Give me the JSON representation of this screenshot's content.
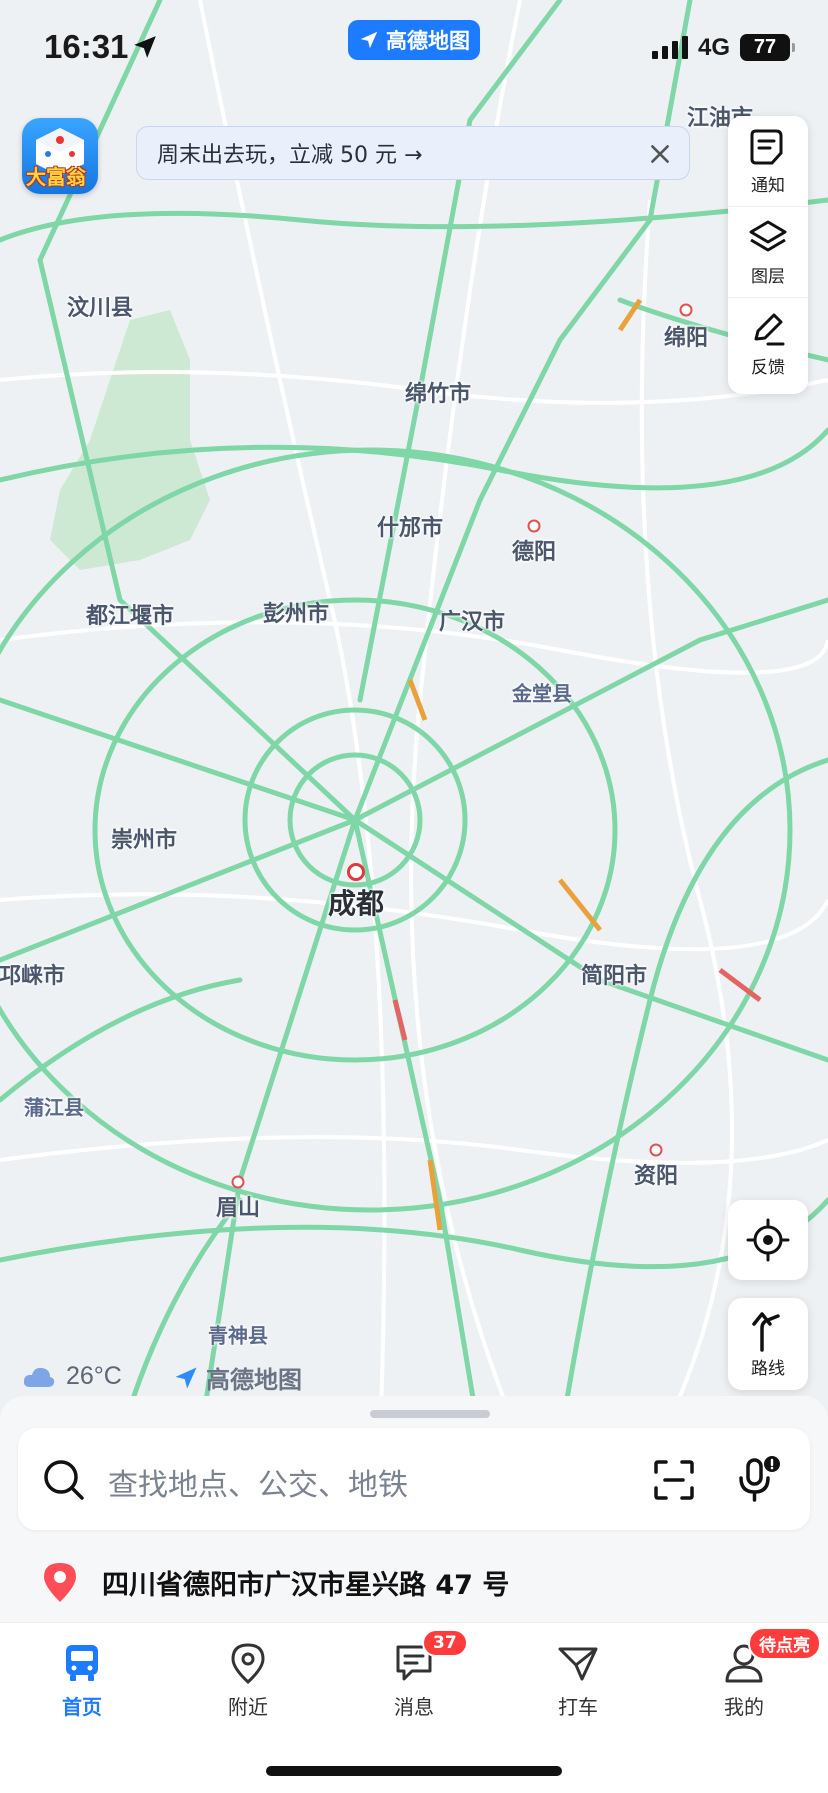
{
  "status_bar": {
    "time": "16:31",
    "network": "4G",
    "battery": "77"
  },
  "app_pill": {
    "label": "高德地图"
  },
  "game": {
    "label": "大富翁"
  },
  "promo": {
    "text": "周末出去玩，立减 50 元 →"
  },
  "toolbar": {
    "notify_label": "通知",
    "layers_label": "图层",
    "feedback_label": "反馈"
  },
  "map": {
    "labels": {
      "jiangyou": "江油市",
      "wenchuan": "汶川县",
      "mianyang": "绵阳",
      "mianzhu": "绵竹市",
      "shifang": "什邡市",
      "deyang": "德阳",
      "dujiangyan": "都江堰市",
      "pengzhou": "彭州市",
      "guanghan": "广汉市",
      "jintang": "金堂县",
      "chongzhou": "崇州市",
      "chengdu": "成都",
      "qionglai": "邛崃市",
      "jianyang": "简阳市",
      "pujiang": "蒲江县",
      "ziyang": "资阳",
      "meishan": "眉山",
      "qingshen": "青神县"
    }
  },
  "route_button": {
    "label": "路线"
  },
  "weather": {
    "temp": "26°C",
    "icon": "cloud-icon"
  },
  "brand": {
    "label": "高德地图"
  },
  "search": {
    "placeholder": "查找地点、公交、地铁"
  },
  "location": {
    "address": "四川省德阳市广汉市星兴路 47 号"
  },
  "tabs": [
    {
      "label": "首页",
      "icon": "bus-icon",
      "active": true
    },
    {
      "label": "附近",
      "icon": "pin-icon"
    },
    {
      "label": "消息",
      "icon": "message-icon",
      "badge": "37"
    },
    {
      "label": "打车",
      "icon": "taxi-icon"
    },
    {
      "label": "我的",
      "icon": "person-icon",
      "badge": "待点亮"
    }
  ],
  "colors": {
    "accent": "#1d7bff",
    "road": "#7fd6a6",
    "badge": "#ff3b3b"
  }
}
